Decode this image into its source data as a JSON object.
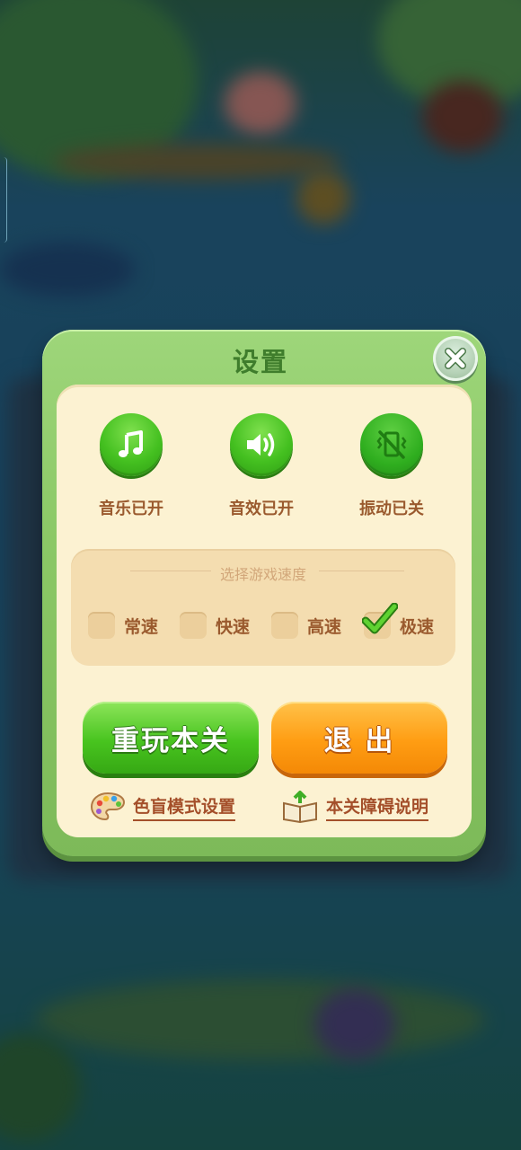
{
  "dialog": {
    "title": "设置",
    "close_icon": "close-icon"
  },
  "toggles": [
    {
      "icon": "music-note-icon",
      "label": "音乐已开"
    },
    {
      "icon": "speaker-icon",
      "label": "音效已开"
    },
    {
      "icon": "vibration-off-icon",
      "label": "振动已关"
    }
  ],
  "speed": {
    "title": "选择游戏速度",
    "options": [
      {
        "label": "常速",
        "checked": false
      },
      {
        "label": "快速",
        "checked": false
      },
      {
        "label": "高速",
        "checked": false
      },
      {
        "label": "极速",
        "checked": true
      }
    ]
  },
  "buttons": {
    "replay_label": "重玩本关",
    "exit_label": "退 出"
  },
  "links": {
    "colorblind_label": "色盲模式设置",
    "accessibility_label": "本关障碍说明"
  },
  "colors": {
    "accent_green": "#44c020",
    "accent_orange": "#ff9d13",
    "text_brown": "#9a5a2e"
  }
}
